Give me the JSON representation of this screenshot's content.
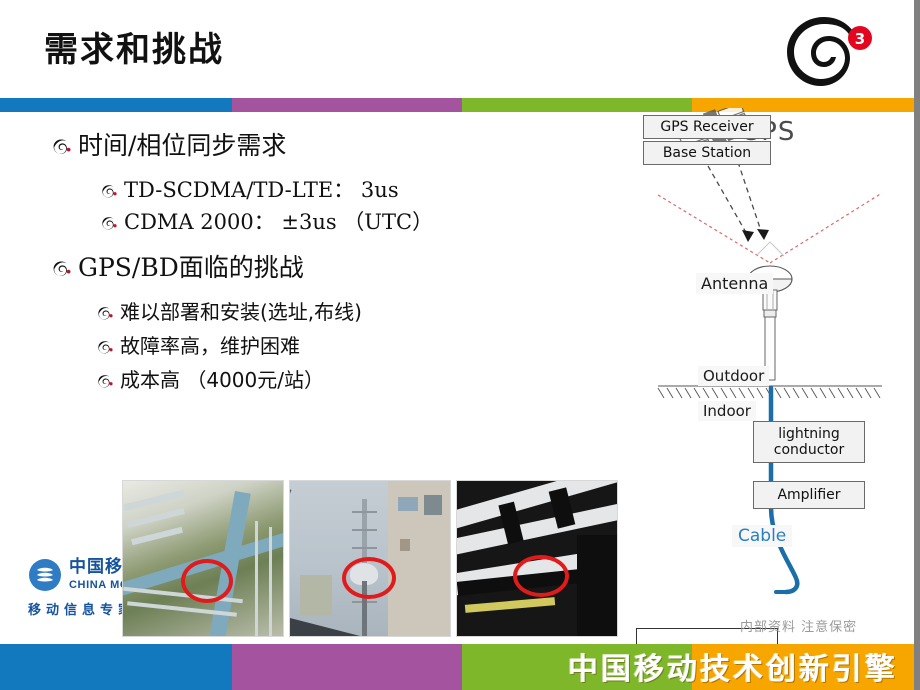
{
  "slide": {
    "title": "需求和挑战",
    "logo_badge": "3"
  },
  "colorbar": {
    "segments": [
      {
        "name": "blue",
        "color": "#1279bf"
      },
      {
        "name": "purple",
        "color": "#a4539f"
      },
      {
        "name": "green",
        "color": "#7fb72b"
      },
      {
        "name": "orange",
        "color": "#f7a600"
      }
    ]
  },
  "bullets": {
    "items": [
      {
        "level": 1,
        "text": "时间/相位同步需求"
      },
      {
        "level": 2,
        "text": "TD-SCDMA/TD-LTE： 3us"
      },
      {
        "level": 2,
        "text": "CDMA 2000： ±3us （UTC）"
      },
      {
        "level": 1,
        "text": "GPS/BD面临的挑战"
      },
      {
        "level": 3,
        "text": "难以部署和安装(选址,布线)"
      },
      {
        "level": 3,
        "text": "故障率高，维护困难"
      },
      {
        "level": 3,
        "text": "成本高 （4000元/站）"
      }
    ]
  },
  "photos": [
    {
      "caption": "rooftop-antenna-photo"
    },
    {
      "caption": "mast-antenna-photo"
    },
    {
      "caption": "structure-antenna-photo"
    }
  ],
  "china_mobile": {
    "cn": "中国移动通信",
    "en": "CHINA MOBILE",
    "tagline": "移动信息专家"
  },
  "diagram": {
    "gps_label": "GPS",
    "antenna_label": "Antenna",
    "outdoor_label": "Outdoor",
    "indoor_label": "Indoor",
    "lightning_line1": "lightning",
    "lightning_line2": "conductor",
    "amplifier_label": "Amplifier",
    "cable_label": "Cable",
    "receiver_label": "GPS Receiver",
    "base_station_label": "Base Station",
    "cable_color": "#1b6fa8"
  },
  "footer": {
    "confidential": "内部资料  注意保密",
    "banner_text": "中国移动技术创新引擎"
  }
}
